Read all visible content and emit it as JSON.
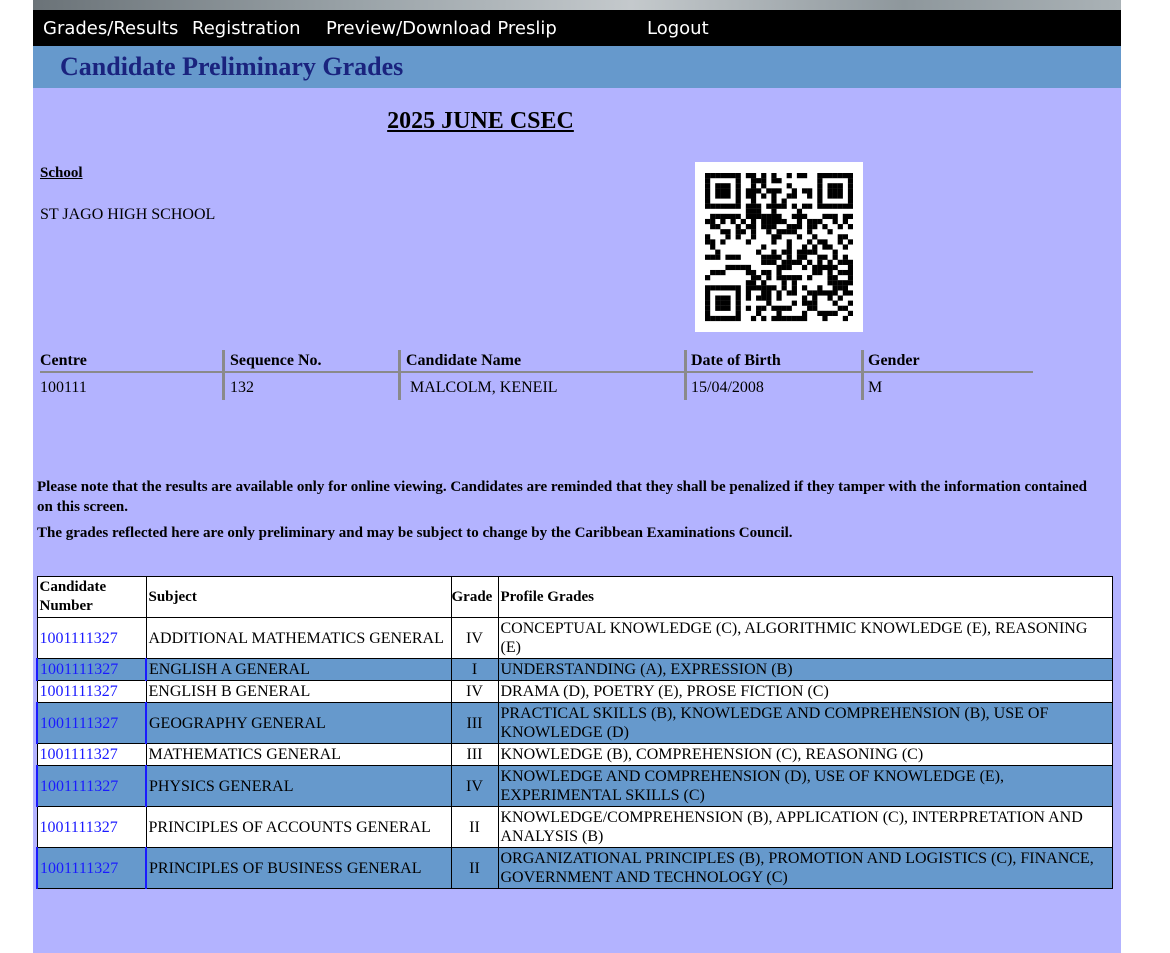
{
  "menu": {
    "items": [
      {
        "label": "Grades/Results"
      },
      {
        "label": "Registration"
      },
      {
        "label": "Preview/Download Preslip"
      },
      {
        "label": "Logout"
      }
    ]
  },
  "page_title": "Candidate Preliminary Grades",
  "exam": "2025 JUNE CSEC",
  "school": {
    "label": "School",
    "name": "ST JAGO HIGH SCHOOL"
  },
  "candidate": {
    "headers": {
      "centre": "Centre",
      "sequence": "Sequence No.",
      "name": "Candidate Name",
      "dob": "Date of Birth",
      "gender": "Gender"
    },
    "values": {
      "centre": "100111",
      "sequence": "132",
      "name": "MALCOLM, KENEIL",
      "dob": "15/04/2008",
      "gender": "M"
    }
  },
  "notices": [
    "Please note that the results are available only for online viewing. Candidates are reminded that they shall be penalized if they tamper with the information contained on this screen.",
    "The grades reflected here are only preliminary and may be subject to change by the Caribbean Examinations Council."
  ],
  "grades_table": {
    "headers": {
      "number": "Candidate Number",
      "subject": "Subject",
      "grade": "Grade",
      "profile": "Profile Grades"
    },
    "rows": [
      {
        "number": "1001111327",
        "subject": "ADDITIONAL MATHEMATICS GENERAL",
        "grade": "IV",
        "profile": "CONCEPTUAL KNOWLEDGE (C), ALGORITHMIC KNOWLEDGE (E), REASONING (E)"
      },
      {
        "number": "1001111327",
        "subject": "ENGLISH A GENERAL",
        "grade": "I",
        "profile": "UNDERSTANDING (A), EXPRESSION (B)"
      },
      {
        "number": "1001111327",
        "subject": "ENGLISH B GENERAL",
        "grade": "IV",
        "profile": "DRAMA (D), POETRY (E), PROSE FICTION (C)"
      },
      {
        "number": "1001111327",
        "subject": "GEOGRAPHY GENERAL",
        "grade": "III",
        "profile": "PRACTICAL SKILLS (B), KNOWLEDGE AND COMPREHENSION (B), USE OF KNOWLEDGE (D)"
      },
      {
        "number": "1001111327",
        "subject": "MATHEMATICS GENERAL",
        "grade": "III",
        "profile": "KNOWLEDGE (B), COMPREHENSION (C), REASONING (C)"
      },
      {
        "number": "1001111327",
        "subject": "PHYSICS GENERAL",
        "grade": "IV",
        "profile": "KNOWLEDGE AND COMPREHENSION (D), USE OF KNOWLEDGE (E), EXPERIMENTAL SKILLS (C)"
      },
      {
        "number": "1001111327",
        "subject": "PRINCIPLES OF ACCOUNTS GENERAL",
        "grade": "II",
        "profile": "KNOWLEDGE/COMPREHENSION (B), APPLICATION (C), INTERPRETATION AND ANALYSIS (B)"
      },
      {
        "number": "1001111327",
        "subject": "PRINCIPLES OF BUSINESS GENERAL",
        "grade": "II",
        "profile": "ORGANIZATIONAL PRINCIPLES (B), PROMOTION AND LOGISTICS (C), FINANCE, GOVERNMENT AND TECHNOLOGY (C)"
      }
    ]
  },
  "colors": {
    "menubar": "#000000",
    "title_bar": "#6699cc",
    "title_text": "#1a237e",
    "content_bg": "#b3b3ff",
    "row_alt": "#6699cc",
    "link": "#1a1aff"
  },
  "icons": [
    "qr-code-icon"
  ]
}
